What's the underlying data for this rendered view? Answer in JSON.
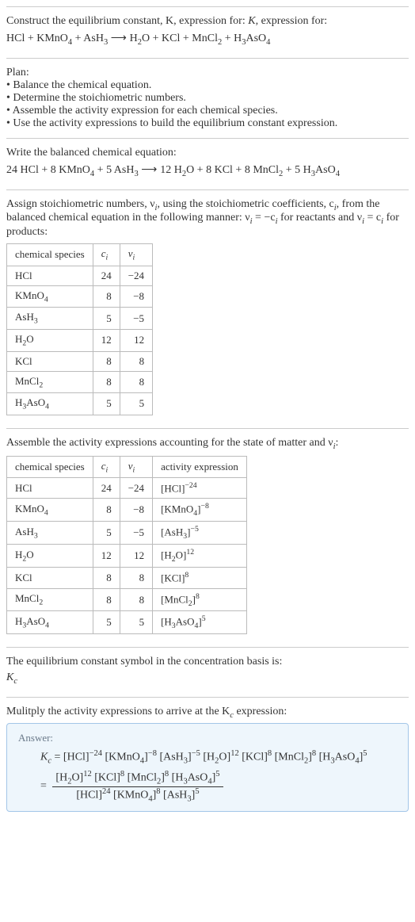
{
  "intro": {
    "line1": "Construct the equilibrium constant, K, expression for:",
    "eqL": "HCl + KMnO",
    "eqL2": " + AsH",
    "arrow": " ⟶ ",
    "eqR": "H",
    "eqR2": "O + KCl + MnCl",
    "eqR3": " + H",
    "eqR4": "AsO"
  },
  "plan": {
    "title": "Plan:",
    "b1": "• Balance the chemical equation.",
    "b2": "• Determine the stoichiometric numbers.",
    "b3": "• Assemble the activity expression for each chemical species.",
    "b4": "• Use the activity expressions to build the equilibrium constant expression."
  },
  "balanced": {
    "title": "Write the balanced chemical equation:",
    "c1": "24",
    "c2": "8",
    "c3": "5",
    "c4": "12",
    "c5": "8",
    "c6": "8",
    "c7": "5"
  },
  "assign": {
    "text1": "Assign stoichiometric numbers, ν",
    "text2": ", using the stoichiometric coefficients, c",
    "text3": ", from the balanced chemical equation in the following manner: ν",
    "text4": " = −c",
    "text5": " for reactants and ν",
    "text6": " = c",
    "text7": " for products:"
  },
  "table1": {
    "h1": "chemical species",
    "h2": "c",
    "h3": "ν",
    "rows": [
      {
        "sp": "HCl",
        "c": "24",
        "v": "−24"
      },
      {
        "sp": "KMnO4",
        "c": "8",
        "v": "−8"
      },
      {
        "sp": "AsH3",
        "c": "5",
        "v": "−5"
      },
      {
        "sp": "H2O",
        "c": "12",
        "v": "12"
      },
      {
        "sp": "KCl",
        "c": "8",
        "v": "8"
      },
      {
        "sp": "MnCl2",
        "c": "8",
        "v": "8"
      },
      {
        "sp": "H3AsO4",
        "c": "5",
        "v": "5"
      }
    ]
  },
  "assemble": {
    "text": "Assemble the activity expressions accounting for the state of matter and ν",
    "colon": ":"
  },
  "table2": {
    "h1": "chemical species",
    "h2": "c",
    "h3": "ν",
    "h4": "activity expression",
    "rows": [
      {
        "sp": "HCl",
        "c": "24",
        "v": "−24",
        "base": "[HCl]",
        "exp": "−24"
      },
      {
        "sp": "KMnO4",
        "c": "8",
        "v": "−8",
        "base": "[KMnO4]",
        "exp": "−8"
      },
      {
        "sp": "AsH3",
        "c": "5",
        "v": "−5",
        "base": "[AsH3]",
        "exp": "−5"
      },
      {
        "sp": "H2O",
        "c": "12",
        "v": "12",
        "base": "[H2O]",
        "exp": "12"
      },
      {
        "sp": "KCl",
        "c": "8",
        "v": "8",
        "base": "[KCl]",
        "exp": "8"
      },
      {
        "sp": "MnCl2",
        "c": "8",
        "v": "8",
        "base": "[MnCl2]",
        "exp": "8"
      },
      {
        "sp": "H3AsO4",
        "c": "5",
        "v": "5",
        "base": "[H3AsO4]",
        "exp": "5"
      }
    ]
  },
  "eqSymbol": {
    "line1": "The equilibrium constant symbol in the concentration basis is:",
    "sym": "K"
  },
  "mult": {
    "text": "Mulitply the activity expressions to arrive at the K",
    "text2": " expression:"
  },
  "answer": {
    "label": "Answer:",
    "lhs": "K",
    "eq": " = ",
    "t1": "[HCl]",
    "e1": "−24",
    "t2": "[KMnO",
    "e2": "−8",
    "t3": "[AsH",
    "e3": "−5",
    "t4": "[H",
    "e4": "12",
    "t5": "[KCl]",
    "e5": "8",
    "t6": "[MnCl",
    "e6": "8",
    "t7": "[H",
    "e7": "5",
    "numA": "[H",
    "numAe": "12",
    "numB": "[KCl]",
    "numBe": "8",
    "numC": "[MnCl",
    "numCe": "8",
    "numD": "[H",
    "numDe": "5",
    "denA": "[HCl]",
    "denAe": "24",
    "denB": "[KMnO",
    "denBe": "8",
    "denC": "[AsH",
    "denCe": "5"
  },
  "chart_data": {
    "type": "table",
    "tables": [
      {
        "columns": [
          "chemical species",
          "c_i",
          "ν_i"
        ],
        "rows": [
          [
            "HCl",
            24,
            -24
          ],
          [
            "KMnO4",
            8,
            -8
          ],
          [
            "AsH3",
            5,
            -5
          ],
          [
            "H2O",
            12,
            12
          ],
          [
            "KCl",
            8,
            8
          ],
          [
            "MnCl2",
            8,
            8
          ],
          [
            "H3AsO4",
            5,
            5
          ]
        ]
      },
      {
        "columns": [
          "chemical species",
          "c_i",
          "ν_i",
          "activity expression"
        ],
        "rows": [
          [
            "HCl",
            24,
            -24,
            "[HCl]^-24"
          ],
          [
            "KMnO4",
            8,
            -8,
            "[KMnO4]^-8"
          ],
          [
            "AsH3",
            5,
            -5,
            "[AsH3]^-5"
          ],
          [
            "H2O",
            12,
            12,
            "[H2O]^12"
          ],
          [
            "KCl",
            8,
            8,
            "[KCl]^8"
          ],
          [
            "MnCl2",
            8,
            8,
            "[MnCl2]^8"
          ],
          [
            "H3AsO4",
            5,
            5,
            "[H3AsO4]^5"
          ]
        ]
      }
    ]
  }
}
